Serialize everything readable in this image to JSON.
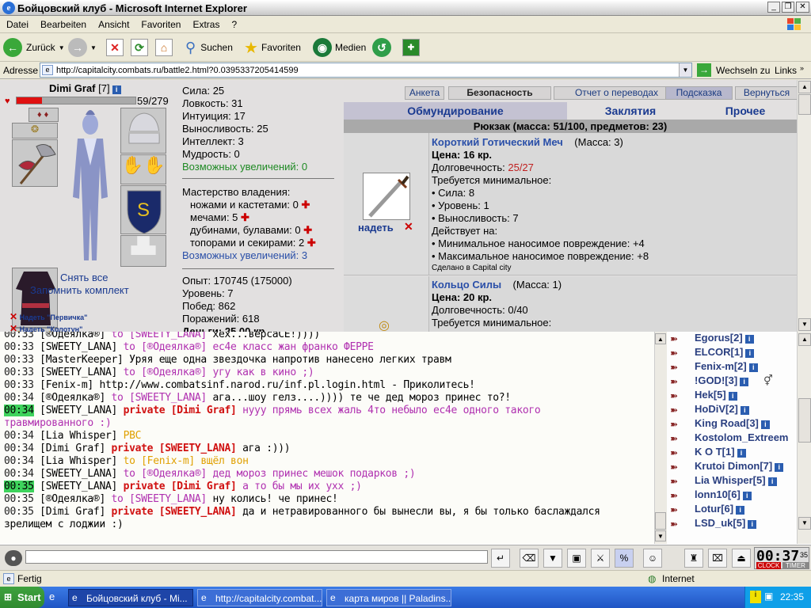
{
  "window": {
    "title": "Бойцовский клуб - Microsoft Internet Explorer"
  },
  "menu": [
    "Datei",
    "Bearbeiten",
    "Ansicht",
    "Favoriten",
    "Extras",
    "?"
  ],
  "toolbar": {
    "back": "Zurück",
    "search": "Suchen",
    "favorites": "Favoriten",
    "media": "Medien"
  },
  "address": {
    "label": "Adresse",
    "url": "http://capitalcity.combats.ru/battle2.html?0.0395337205414599",
    "go": "Wechseln zu",
    "links": "Links"
  },
  "character": {
    "name": "Dimi Graf",
    "level": "[7]",
    "hp": "59/279",
    "hp_fraction": 0.21,
    "actions": {
      "undress": "Снять все",
      "remember": "Запомнить комплект"
    },
    "sets": [
      "Надеть \"Первичка\"",
      "Надеть \"Колотун\""
    ]
  },
  "stats": {
    "lines": [
      "Сила: 25",
      "Ловкость: 31",
      "Интуиция: 17",
      "Выносливость: 25",
      "Интеллект: 3",
      "Мудрость: 0"
    ],
    "increases": "Возможных увеличений: 0",
    "mastery_title": "Мастерство владения:",
    "mastery": [
      "ножами и кастетами: 0",
      "мечами: 5",
      "дубинами, булавами: 0",
      "топорами и секирами: 2"
    ],
    "mastery_increases": "Возможных увеличений: 3",
    "progress": [
      "Опыт: 170745 (175000)",
      "Уровень: 7",
      "Побед: 862",
      "Поражений: 618",
      "Деньги: 25.00 кр."
    ]
  },
  "nav_buttons": [
    "Анкета",
    "Безопасность",
    "Отчет о переводах",
    "Подсказка",
    "Вернуться"
  ],
  "tabs": [
    "Обмундирование",
    "Заклятия",
    "Прочее"
  ],
  "backpack": "Рюкзак (масса: 51/100, предметов: 23)",
  "items": [
    {
      "name": "Короткий Готический Меч",
      "mass": "(Масса: 3)",
      "price": "Цена: 16 кр.",
      "durability_label": "Долговечность: ",
      "durability_value": "25/27",
      "req_title": "Требуется минимальное:",
      "reqs": [
        "• Сила: 8",
        "• Уровень: 1",
        "• Выносливость: 7"
      ],
      "acts_title": "Действует на:",
      "acts": [
        "• Минимальное наносимое повреждение: +4",
        "• Максимальное наносимое повреждение: +8"
      ],
      "made": "Сделано в Capital city",
      "wear": "надеть"
    },
    {
      "name": "Кольцо Силы",
      "mass": "(Масса: 1)",
      "price": "Цена: 20 кр.",
      "durability_label": "Долговечность: ",
      "durability_value": "0/40",
      "req_title": "Требуется минимальное:"
    }
  ],
  "chat": [
    {
      "time": "00:33",
      "nick": "[®Одеялка®]",
      "to": "to [SWEETY_LANA]",
      "msg": "хех...версаCE!))))"
    },
    {
      "time": "00:33",
      "nick": "[SWEETY_LANA]",
      "to": "to [®Одеялка®]",
      "msg": "ес4е класс жан франко ФЕРРЕ"
    },
    {
      "time": "00:33",
      "nick": "[MasterKeeper]",
      "to": "",
      "msg": "Уряя еще одна звездочка напротив нанесено легких травм"
    },
    {
      "time": "00:33",
      "nick": "[SWEETY_LANA]",
      "to": "to [®Одеялка®]",
      "msg": "угу как в кино ;)"
    },
    {
      "time": "00:33",
      "nick": "[Fenix-m]",
      "to": "",
      "msg": "http://www.combatsinf.narod.ru/inf.pl.login.html - Приколитесь!"
    },
    {
      "time": "00:34",
      "nick": "[®Одеялка®]",
      "to": "to [SWEETY_LANA]",
      "msg": "ага...шоу гелз....)))) те че дед мороз принес то?!"
    },
    {
      "time": "00:34",
      "nick": "[SWEETY_LANA]",
      "priv": "private [Dimi Graf]",
      "msg": "нууу прямь всех жаль 4то небыло ес4е одного такого",
      "msg2": "травмированного :)",
      "hl": true
    },
    {
      "time": "00:34",
      "nick": "[Lia Whisper]",
      "sys": "PBC"
    },
    {
      "time": "00:34",
      "nick": "[Dimi Graf]",
      "priv": "private [SWEETY_LANA]",
      "msg": "ага :)))"
    },
    {
      "time": "00:34",
      "nick": "[Lia Whisper]",
      "sys": "to [Fenix-m] вщёл вон"
    },
    {
      "time": "00:34",
      "nick": "[SWEETY_LANA]",
      "to": "to [®Одеялка®]",
      "msg": "дед мороз принес мешок подарков ;)"
    },
    {
      "time": "00:35",
      "nick": "[SWEETY_LANA]",
      "priv": "private [Dimi Graf]",
      "msg": "а то бы мы их ухх ;)",
      "hl": true
    },
    {
      "time": "00:35",
      "nick": "[®Одеялка®]",
      "to": "to [SWEETY_LANA]",
      "msg": "ну колись! че принес!"
    },
    {
      "time": "00:35",
      "nick": "[Dimi Graf]",
      "priv": "private [SWEETY_LANA]",
      "msg": "да и нетравированного бы вынесли вы, я бы только баслаждался",
      "msg2": "зрелищем с лоджии :)"
    }
  ],
  "users": [
    "Egorus[2]",
    "ELCOR[1]",
    "Fenix-m[2]",
    "!GOD![3]",
    "Hek[5]",
    "HoDiV[2]",
    "King Road[3]",
    "Kostolom_Extreem",
    "K O T[1]",
    "Krutoi Dimon[7]",
    "Lia Whisper[5]",
    "lonn10[6]",
    "Lotur[6]",
    "LSD_uk[5]"
  ],
  "timer": {
    "time": "00:37",
    "sec": "35",
    "clock": "CLOCK",
    "timer": "TIMER"
  },
  "status": {
    "text": "Fertig",
    "zone": "Internet"
  },
  "taskbar": {
    "start": "Start",
    "tasks": [
      "Бойцовский клуб - Mi...",
      "http://capitalcity.combat...",
      "карта миров || Paladins...."
    ],
    "clock": "22:35"
  }
}
